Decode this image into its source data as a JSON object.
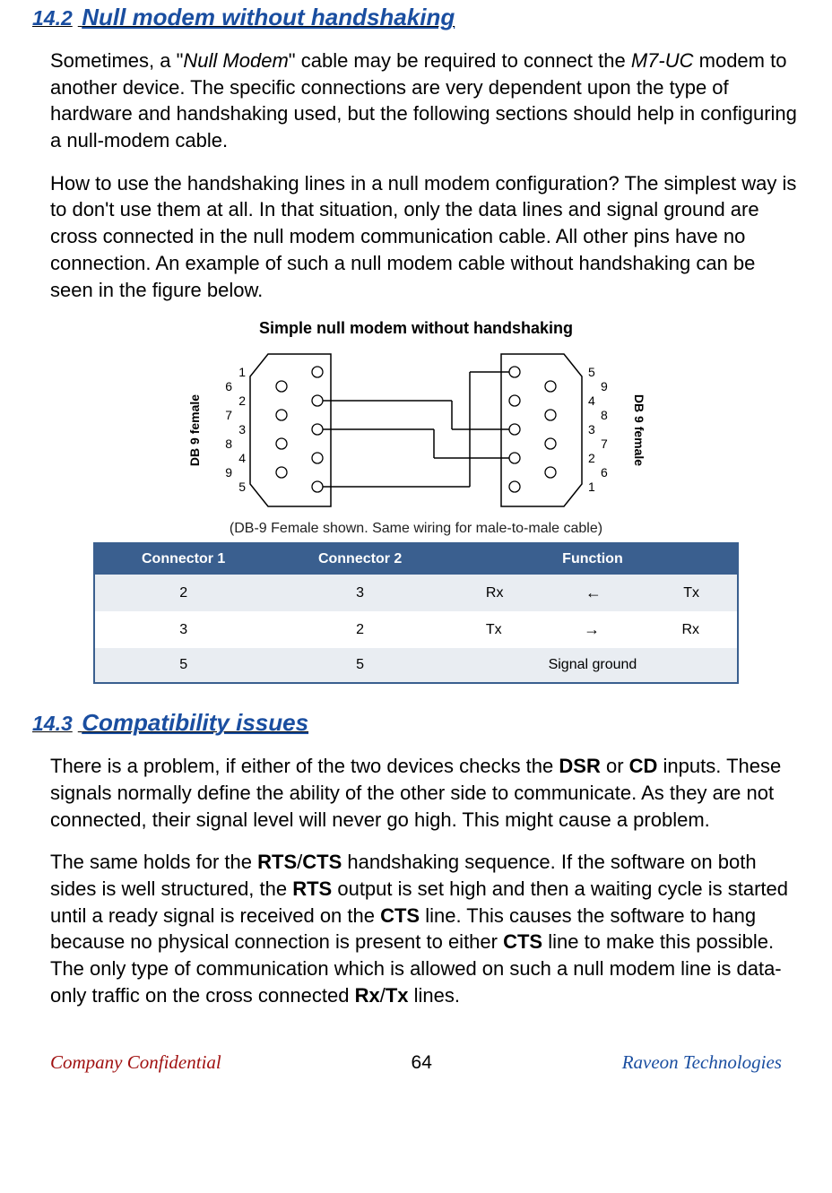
{
  "section1": {
    "num": "14.2",
    "title": "Null modem without handshaking",
    "para1_a": "Sometimes, a \"",
    "para1_em1": "Null Modem",
    "para1_b": "\" cable may be required to connect the ",
    "para1_em2": "M7-UC",
    "para1_c": " modem to another device.  The specific connections are very dependent upon the type of hardware and handshaking used, but the following sections should help in configuring a null-modem cable.",
    "para2": "How to use the handshaking lines in a null modem configuration? The simplest way is to don't use them at all. In that situation, only the data lines and signal ground are cross connected in the null modem communication cable. All other pins have no connection. An example of such a null modem cable without handshaking can be seen in the figure below."
  },
  "figure": {
    "title": "Simple null modem without handshaking",
    "caption": "(DB-9 Female shown.  Same wiring for male-to-male cable)",
    "left_label": "DB 9 female",
    "right_label": "DB 9 female",
    "left_pins_front": [
      "1",
      "2",
      "3",
      "4",
      "5"
    ],
    "left_pins_back": [
      "6",
      "7",
      "8",
      "9"
    ],
    "right_pins_front": [
      "5",
      "4",
      "3",
      "2",
      "1"
    ],
    "right_pins_back": [
      "9",
      "8",
      "7",
      "6"
    ]
  },
  "table": {
    "headers": [
      "Connector 1",
      "Connector 2",
      "Function"
    ],
    "rows": [
      {
        "c1": "2",
        "c2": "3",
        "fa": "Rx",
        "arrow": "←",
        "fb": "Tx"
      },
      {
        "c1": "3",
        "c2": "2",
        "fa": "Tx",
        "arrow": "→",
        "fb": "Rx"
      },
      {
        "c1": "5",
        "c2": "5",
        "fsingle": "Signal ground"
      }
    ]
  },
  "section2": {
    "num": "14.3",
    "title": "Compatibility issues",
    "para1_a": "There is a problem, if either of the two devices checks the ",
    "para1_b1": "DSR",
    "para1_b": " or ",
    "para1_b2": "CD",
    "para1_c": " inputs. These signals normally define the ability of the other side to communicate. As they are not connected, their signal level will never go high. This might cause a problem.",
    "para2_a": "The same holds for the ",
    "para2_b1": "RTS",
    "para2_b": "/",
    "para2_b2": "CTS",
    "para2_c": " handshaking sequence. If the software on both sides is well structured, the ",
    "para2_b3": "RTS",
    "para2_d": " output is set high and then a waiting cycle is started until a ready signal is received on the ",
    "para2_b4": "CTS",
    "para2_e": " line. This causes the software to hang because no physical connection is present to either ",
    "para2_b5": "CTS",
    "para2_f": " line to make this possible. The only type of communication which is allowed on such a null modem line is data-only traffic on the cross connected ",
    "para2_b6": "Rx",
    "para2_g": "/",
    "para2_b7": "Tx",
    "para2_h": " lines."
  },
  "footer": {
    "left": "Company Confidential",
    "center": "64",
    "right": "Raveon Technologies"
  }
}
